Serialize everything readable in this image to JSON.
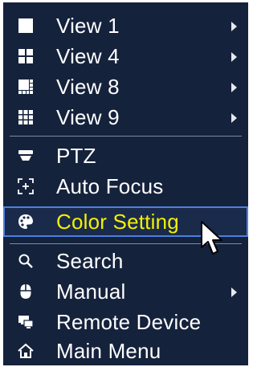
{
  "menu": {
    "items": [
      {
        "label": "View 1",
        "icon": "single-view-icon",
        "submenu": true
      },
      {
        "label": "View 4",
        "icon": "quad-view-icon",
        "submenu": true
      },
      {
        "label": "View 8",
        "icon": "eight-view-icon",
        "submenu": true
      },
      {
        "label": "View 9",
        "icon": "nine-view-icon",
        "submenu": true
      },
      {
        "label": "PTZ",
        "icon": "ptz-icon",
        "submenu": false
      },
      {
        "label": "Auto Focus",
        "icon": "focus-icon",
        "submenu": false
      },
      {
        "label": "Color Setting",
        "icon": "palette-icon",
        "submenu": false,
        "selected": true
      },
      {
        "label": "Search",
        "icon": "search-icon",
        "submenu": false
      },
      {
        "label": "Manual",
        "icon": "mouse-icon",
        "submenu": true
      },
      {
        "label": "Remote Device",
        "icon": "remote-device-icon",
        "submenu": false
      },
      {
        "label": "Main Menu",
        "icon": "home-icon",
        "submenu": false
      }
    ]
  },
  "colors": {
    "background": "#15223c",
    "text": "#ffffff",
    "selected_text": "#f3f100",
    "selected_border": "#4e7fe0",
    "divider": "#7d8aa3"
  }
}
